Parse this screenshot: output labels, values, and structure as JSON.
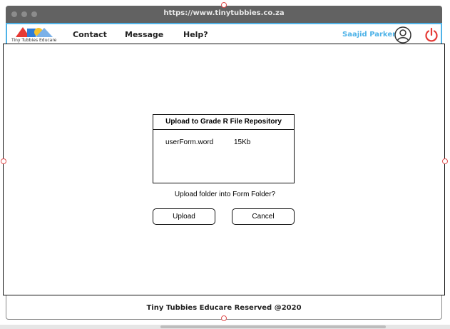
{
  "browser": {
    "url": "https://www.tinytubbies.co.za"
  },
  "header": {
    "logo_text": "Tiny Tubbies Educare",
    "nav": [
      {
        "label": "Contact"
      },
      {
        "label": "Message"
      },
      {
        "label": "Help?"
      }
    ],
    "username": "Saajid Parker",
    "accent_color": "#4fb3e8",
    "power_color": "#e53935"
  },
  "dialog": {
    "title": "Upload to Grade R File Repository",
    "file": {
      "name": "userForm.word",
      "size": "15Kb"
    }
  },
  "prompt": "Upload folder into Form Folder?",
  "actions": {
    "upload_label": "Upload",
    "cancel_label": "Cancel"
  },
  "footer": {
    "text": "Tiny Tubbies Educare Reserved  @2020"
  },
  "icons": [
    "user-avatar-icon",
    "power-icon",
    "logo-icon"
  ]
}
